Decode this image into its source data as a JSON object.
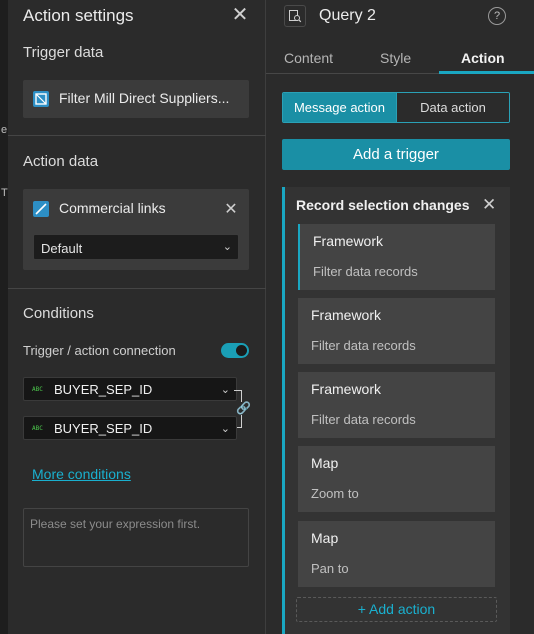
{
  "left_panel": {
    "edge_fragments": [
      "e",
      "T"
    ],
    "title": "Action settings",
    "trigger_data": {
      "label": "Trigger data",
      "source": "Filter Mill Direct Suppliers..."
    },
    "action_data": {
      "label": "Action data",
      "target": "Commercial links",
      "dropdown_value": "Default"
    },
    "conditions": {
      "label": "Conditions",
      "toggle_label": "Trigger / action connection",
      "toggle_on": true,
      "field_type_badge": "ABC",
      "trigger_field": "BUYER_SEP_ID",
      "action_field": "BUYER_SEP_ID",
      "more_conditions": "More conditions",
      "expression_placeholder": "Please set your expression first."
    }
  },
  "right_panel": {
    "title": "Query 2",
    "help_icon": "?",
    "tabs": [
      {
        "label": "Content",
        "active": false
      },
      {
        "label": "Style",
        "active": false
      },
      {
        "label": "Action",
        "active": true
      }
    ],
    "segment": {
      "message_action": "Message action",
      "data_action": "Data action"
    },
    "add_trigger": "Add a trigger",
    "trigger_group": {
      "title": "Record selection changes",
      "actions": [
        {
          "title": "Framework",
          "subtitle": "Filter data records",
          "selected": true
        },
        {
          "title": "Framework",
          "subtitle": "Filter data records",
          "selected": false
        },
        {
          "title": "Framework",
          "subtitle": "Filter data records",
          "selected": false
        },
        {
          "title": "Map",
          "subtitle": "Zoom to",
          "selected": false
        },
        {
          "title": "Map",
          "subtitle": "Pan to",
          "selected": false
        }
      ],
      "add_action": "+ Add action"
    }
  },
  "colors": {
    "accent": "#1aa7c2",
    "accent_button": "#1a8fa5",
    "link": "#1ab0cf",
    "panel_bg": "#2b2b2b"
  }
}
